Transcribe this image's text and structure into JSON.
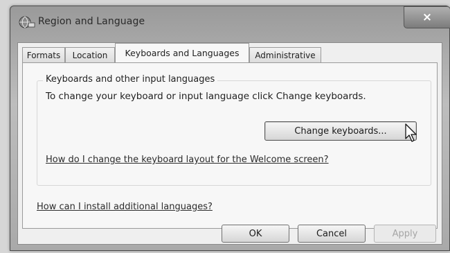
{
  "window": {
    "title": "Region and Language",
    "close_glyph": "×"
  },
  "tabs": [
    {
      "label": "Formats"
    },
    {
      "label": "Location"
    },
    {
      "label": "Keyboards and Languages",
      "active": true
    },
    {
      "label": "Administrative"
    }
  ],
  "keyboards_group": {
    "title": "Keyboards and other input languages",
    "description": "To change your keyboard or input language click Change keyboards.",
    "change_button_label": "Change keyboards...",
    "welcome_link": "How do I change the keyboard layout for the Welcome screen?"
  },
  "install_link": "How can I install additional languages?",
  "footer": {
    "ok_label": "OK",
    "cancel_label": "Cancel",
    "apply_label": "Apply"
  },
  "icons": [
    "globe-icon",
    "close-icon",
    "mouse-pointer-icon"
  ]
}
